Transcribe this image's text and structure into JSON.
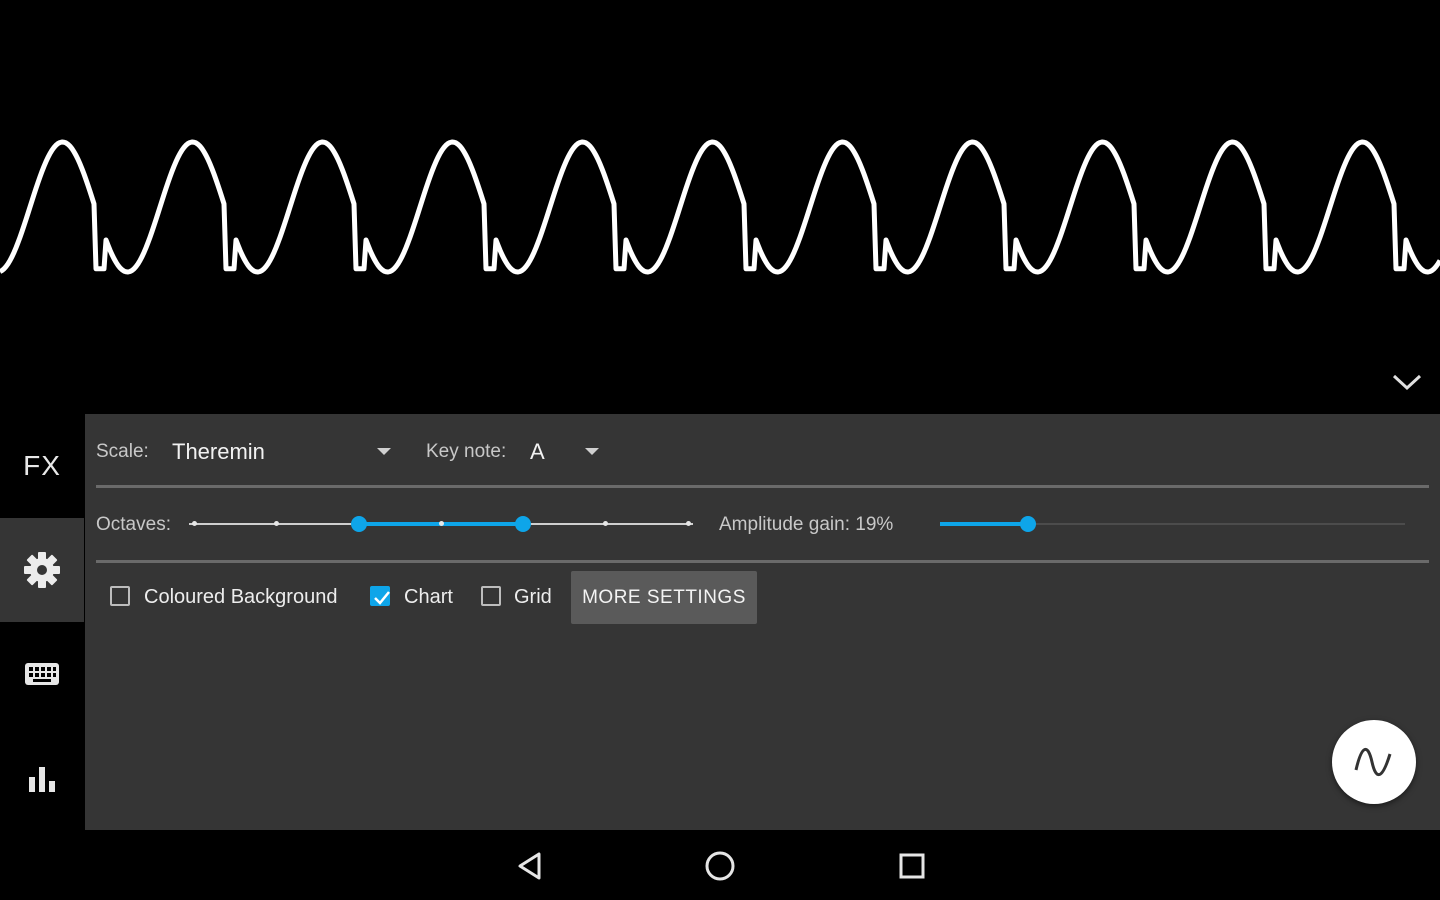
{
  "waveform": {
    "display": "continuous sine-like waveform trace",
    "color": "#ffffff"
  },
  "controls": {
    "scale_label": "Scale:",
    "scale_value": "Theremin",
    "keynote_label": "Key note:",
    "keynote_value": "A",
    "octaves_label": "Octaves:",
    "octaves_range": {
      "steps": 7,
      "low_step": 2,
      "high_step": 4
    },
    "amplitude_label": "Amplitude gain: 19%",
    "amplitude_fraction": 0.19,
    "checkboxes": [
      {
        "label": "Coloured Background",
        "checked": false
      },
      {
        "label": "Chart",
        "checked": true
      },
      {
        "label": "Grid",
        "checked": false
      }
    ],
    "more_settings": "MORE SETTINGS"
  },
  "rail": {
    "fx_label": "FX"
  },
  "icons": {
    "collapse": "chevron-down-icon",
    "settings": "gear-icon",
    "keyboard": "keyboard-icon",
    "chart": "bar-chart-icon",
    "fab": "sine-wave-icon",
    "back": "back-triangle-icon",
    "home": "home-circle-icon",
    "recents": "recents-square-icon"
  },
  "colors": {
    "accent": "#0ea5e9",
    "panel": "#353535",
    "background": "#000000"
  }
}
